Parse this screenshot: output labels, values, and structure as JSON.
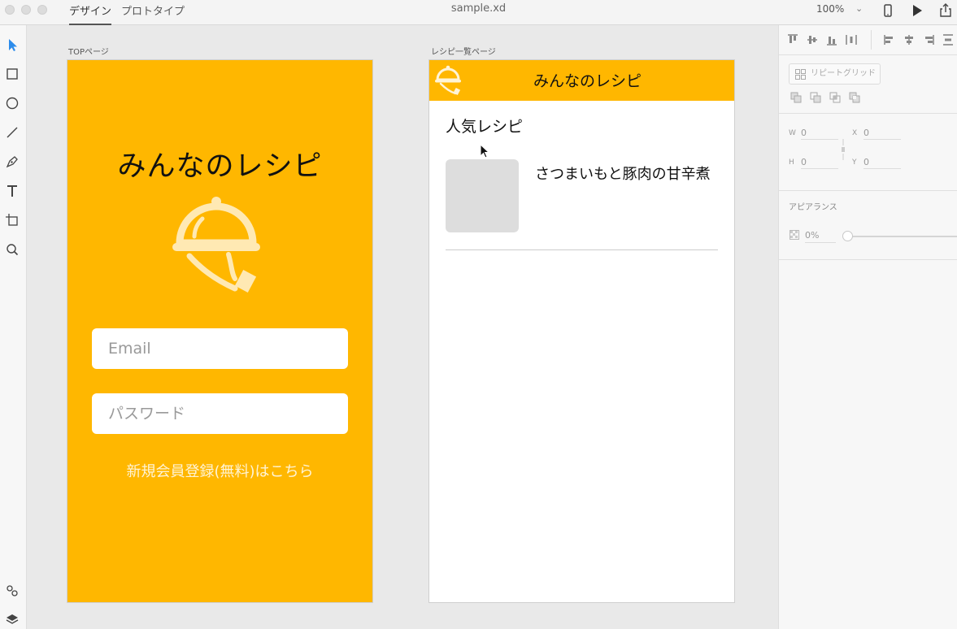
{
  "titlebar": {
    "tabs": [
      {
        "label": "デザイン",
        "active": true
      },
      {
        "label": "プロトタイプ",
        "active": false
      }
    ],
    "document_title": "sample.xd",
    "zoom": "100%"
  },
  "toolbar": {
    "tools": [
      "select-icon",
      "rectangle-icon",
      "ellipse-icon",
      "line-icon",
      "pen-icon",
      "text-icon",
      "artboard-icon",
      "zoom-icon"
    ],
    "bottom": [
      "symbols-icon",
      "layers-icon"
    ]
  },
  "canvas": {
    "artboards": [
      {
        "label": "TOPページ",
        "title": "みんなのレシピ",
        "email_placeholder": "Email",
        "password_placeholder": "パスワード",
        "signup_link": "新規会員登録(無料)はこちら"
      },
      {
        "label": "レシピ一覧ページ",
        "header_title": "みんなのレシピ",
        "section_title": "人気レシピ",
        "recipes": [
          {
            "name": "さつまいもと豚肉の甘辛煮"
          }
        ]
      }
    ],
    "brand_color": "#ffb700"
  },
  "panel": {
    "repeat_grid_label": "リピートグリッド",
    "fields": {
      "w_label": "W",
      "w_value": "0",
      "x_label": "X",
      "x_value": "0",
      "h_label": "H",
      "h_value": "0",
      "y_label": "Y",
      "y_value": "0"
    },
    "appearance_label": "アピアランス",
    "opacity_value": "0%",
    "opacity_level": 0
  }
}
